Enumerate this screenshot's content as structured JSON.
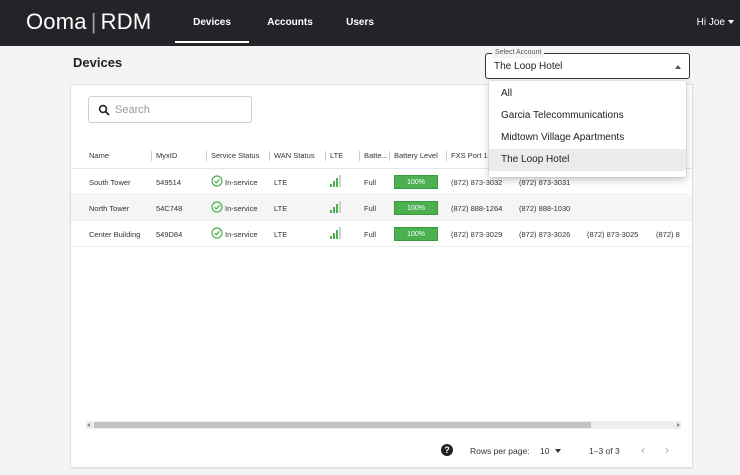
{
  "brand": {
    "name": "Ooma",
    "sep": "|",
    "product": "RDM"
  },
  "nav": [
    {
      "label": "Devices",
      "active": true
    },
    {
      "label": "Accounts",
      "active": false
    },
    {
      "label": "Users",
      "active": false
    }
  ],
  "user": {
    "greeting": "Hi Joe"
  },
  "page": {
    "title": "Devices"
  },
  "account_select": {
    "legend": "Select Account",
    "value": "The Loop Hotel",
    "options": [
      "All",
      "Garcia Telecommunications",
      "Midtown Village Apartments",
      "The Loop Hotel"
    ]
  },
  "search": {
    "placeholder": "Search"
  },
  "table": {
    "columns": [
      "Name",
      "MyxID",
      "Service Status",
      "WAN Status",
      "LTE",
      "Batte...",
      "Battery Level",
      "FXS Port 1"
    ],
    "rows": [
      {
        "name": "South Tower",
        "myxid": "549514",
        "service_status": "In-service",
        "wan": "LTE",
        "lte_signal_bars": 3,
        "battery": "Full",
        "battery_level": "100%",
        "fxs1": "(872) 873-3032",
        "fxs2": "(872) 873-3031",
        "fxs3": "",
        "fxs4": ""
      },
      {
        "name": "North Tower",
        "myxid": "54C748",
        "service_status": "In-service",
        "wan": "LTE",
        "lte_signal_bars": 3,
        "battery": "Full",
        "battery_level": "100%",
        "fxs1": "(872) 888-1264",
        "fxs2": "(872) 888-1030",
        "fxs3": "",
        "fxs4": ""
      },
      {
        "name": "Center Building",
        "myxid": "549D84",
        "service_status": "In-service",
        "wan": "LTE",
        "lte_signal_bars": 3,
        "battery": "Full",
        "battery_level": "100%",
        "fxs1": "(872) 873-3029",
        "fxs2": "(872) 873-3026",
        "fxs3": "(872) 873-3025",
        "fxs4": "(872) 8"
      }
    ]
  },
  "pagination": {
    "rows_per_page_label": "Rows per page:",
    "rows_per_page": "10",
    "range": "1–3 of 3",
    "prev": "‹",
    "next": "›",
    "help": "?"
  },
  "colors": {
    "topbar": "#222427",
    "accent_green": "#4caf50",
    "status_ok": "#4caf50"
  }
}
